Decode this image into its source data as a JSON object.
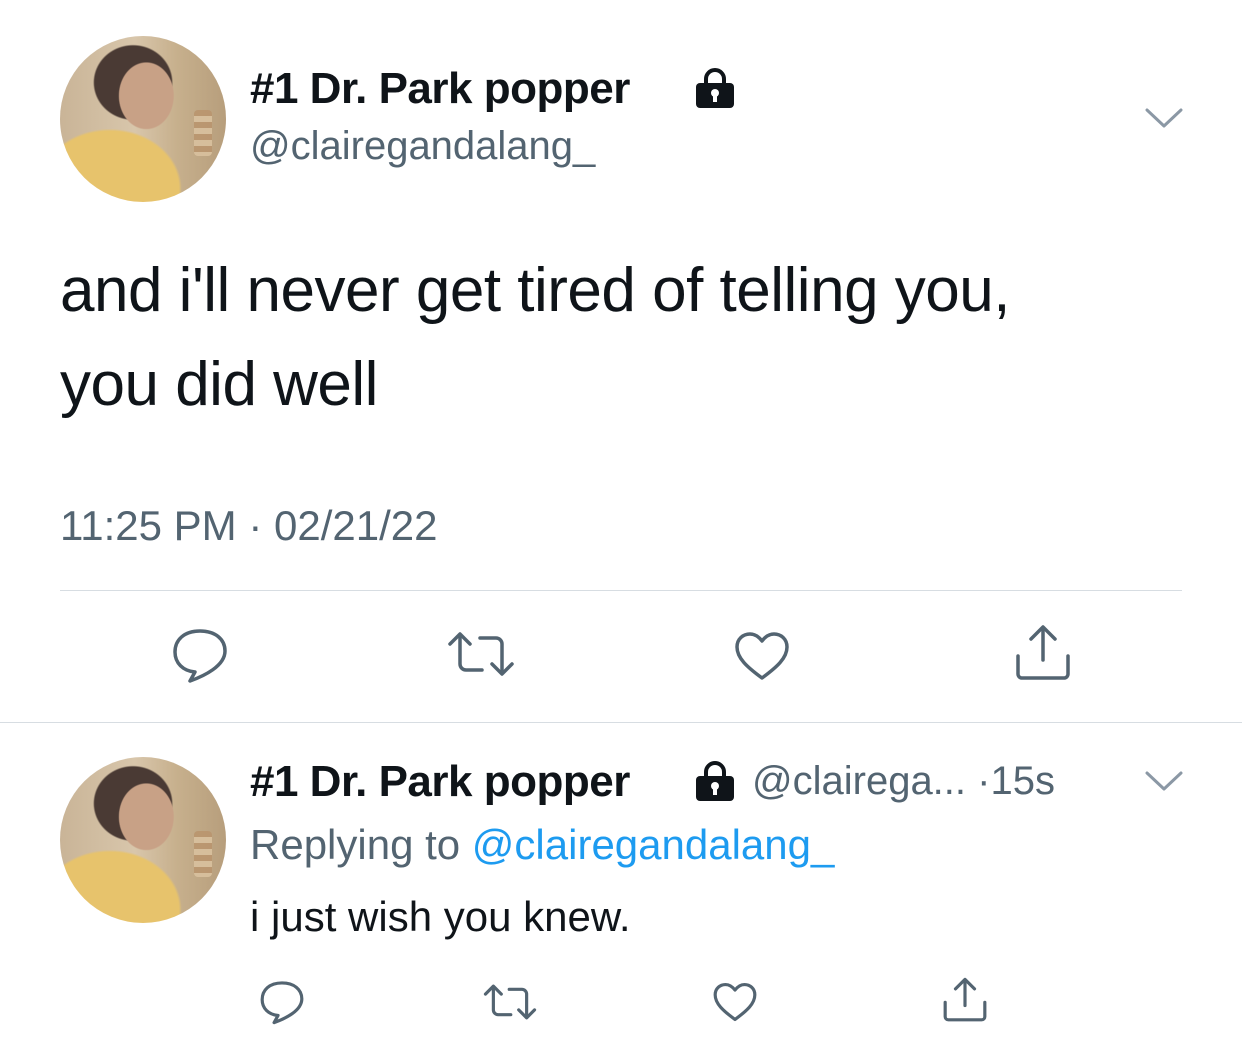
{
  "main_tweet": {
    "author": {
      "display_name": "#1 Dr. Park popper",
      "handle": "@clairegandalang_"
    },
    "text_line1": "and i'll never get tired of telling you,",
    "text_line2": "you did well",
    "time": "11:25 PM",
    "date": "02/21/22",
    "separator": "·",
    "actions": [
      "reply-icon",
      "retweet-icon",
      "like-icon",
      "share-icon"
    ]
  },
  "reply_tweet": {
    "author": {
      "display_name": "#1 Dr. Park popper",
      "handle_truncated": "@clairega..."
    },
    "separator": "·",
    "age": "15s",
    "replying_to_label": "Replying to",
    "replying_to_handle": "@clairegandalang_",
    "text": "i just wish you knew.",
    "actions": [
      "reply-icon",
      "retweet-icon",
      "like-icon",
      "share-icon"
    ]
  },
  "colors": {
    "text_primary": "#0f1419",
    "text_secondary": "#536471",
    "link": "#1d9bf0",
    "icon": "#536471",
    "divider": "#d7dde2"
  }
}
